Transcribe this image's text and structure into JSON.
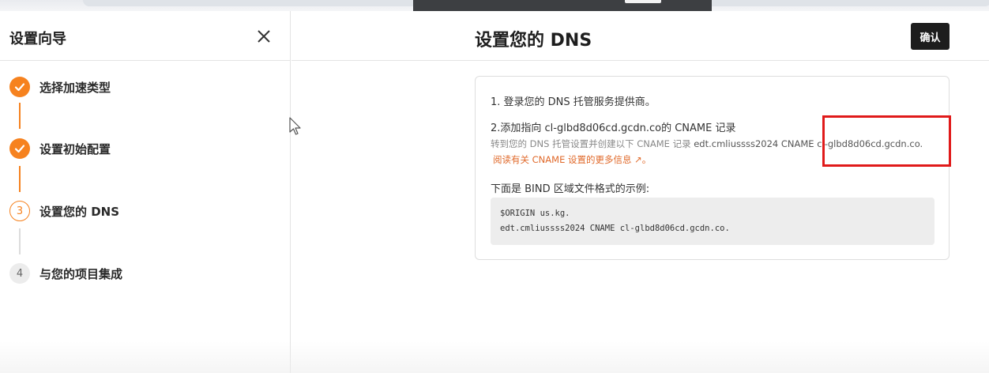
{
  "sidebar": {
    "title": "设置向导",
    "steps": [
      {
        "number": "1",
        "label": "选择加速类型",
        "state": "done"
      },
      {
        "number": "2",
        "label": "设置初始配置",
        "state": "done"
      },
      {
        "number": "3",
        "label": "设置您的 DNS",
        "state": "active"
      },
      {
        "number": "4",
        "label": "与您的项目集成",
        "state": "todo"
      }
    ]
  },
  "main": {
    "title": "设置您的 DNS",
    "confirm_label": "确认",
    "card": {
      "step1": "1. 登录您的 DNS 托管服务提供商。",
      "step2": "2.添加指向 cl-glbd8d06cd.gcdn.co的 CNAME 记录",
      "desc_prefix": "转到您的 DNS 托管设置并创建以下 CNAME 记录 ",
      "desc_record": "edt.cmliussss2024 CNAME cl-glbd8d06cd.gcdn.co.",
      "learn_more": "阅读有关 CNAME 设置的更多信息 ↗。",
      "example_label": "下面是 BIND 区域文件格式的示例:",
      "code_line1": "$ORIGIN us.kg.",
      "code_line2": "edt.cmliussss2024 CNAME cl-glbd8d06cd.gcdn.co."
    }
  },
  "colors": {
    "accent": "#f6821f",
    "highlight": "#e01a1a",
    "button_bg": "#1d1d1d"
  }
}
